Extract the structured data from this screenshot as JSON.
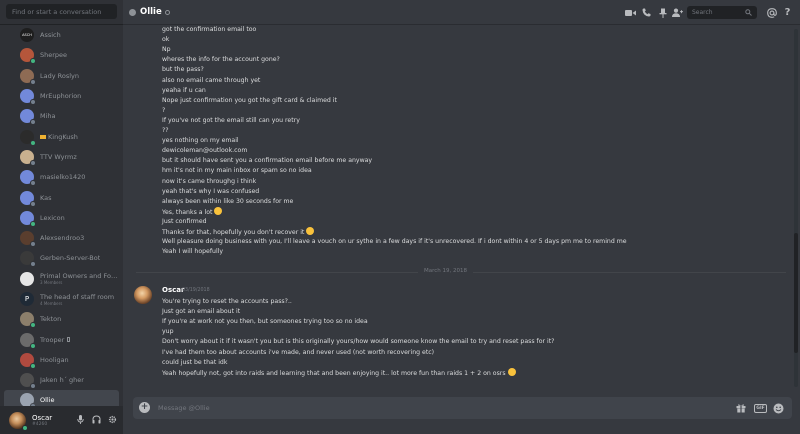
{
  "sidebar": {
    "search_placeholder": "Find or start a conversation",
    "items": [
      {
        "name": "Assich",
        "sub": "",
        "avatar_color": "#1e1e1e",
        "avatar_text": "ASCH",
        "status": "#43b581"
      },
      {
        "name": "Sherpee",
        "sub": "",
        "avatar_color": "#b5563b",
        "avatar_text": "",
        "status": "#43b581"
      },
      {
        "name": "Lady Roslyn",
        "sub": "",
        "avatar_color": "#8e6b54",
        "avatar_text": "",
        "status": "#747f8d"
      },
      {
        "name": "MrEuphorion",
        "sub": "",
        "avatar_color": "#7289da",
        "avatar_text": "",
        "status": "#747f8d"
      },
      {
        "name": "Miha",
        "sub": "",
        "avatar_color": "#7289da",
        "avatar_text": "",
        "status": "#747f8d"
      },
      {
        "name": "KingKush",
        "sub": "",
        "avatar_color": "#2b2b2b",
        "avatar_text": "",
        "status": "#43b581",
        "badge": true
      },
      {
        "name": "TTV Wyrmz",
        "sub": "",
        "avatar_color": "#c9b18f",
        "avatar_text": "",
        "status": "#747f8d"
      },
      {
        "name": "masielko1420",
        "sub": "",
        "avatar_color": "#7289da",
        "avatar_text": "",
        "status": "#747f8d"
      },
      {
        "name": "Kas",
        "sub": "",
        "avatar_color": "#7289da",
        "avatar_text": "",
        "status": "#747f8d"
      },
      {
        "name": "Lexicon",
        "sub": "",
        "avatar_color": "#7289da",
        "avatar_text": "",
        "status": "#43b581"
      },
      {
        "name": "Alexsendroo3",
        "sub": "",
        "avatar_color": "#5a3e2e",
        "avatar_text": "",
        "status": "#747f8d"
      },
      {
        "name": "Gerben-Server-Bot",
        "sub": "",
        "avatar_color": "#3a3a3a",
        "avatar_text": "",
        "status": "#747f8d"
      },
      {
        "name": "Primal Owners and Fou...",
        "sub": "3 Members",
        "avatar_color": "#e6e6e6",
        "avatar_text": "",
        "status": ""
      },
      {
        "name": "The head of staff room",
        "sub": "4 Members",
        "avatar_color": "#1f2a36",
        "avatar_text": "P",
        "status": ""
      },
      {
        "name": "Tekton",
        "sub": "",
        "avatar_color": "#8c7f6b",
        "avatar_text": "",
        "status": "#43b581"
      },
      {
        "name": "Trooper",
        "sub": "",
        "avatar_color": "#6b6b6b",
        "avatar_text": "",
        "status": "#43b581",
        "phone": true
      },
      {
        "name": "Hooligan",
        "sub": "",
        "avatar_color": "#b04a3f",
        "avatar_text": "",
        "status": "#43b581"
      },
      {
        "name": "Jaken h´ gher",
        "sub": "",
        "avatar_color": "#4f4f4f",
        "avatar_text": "",
        "status": "#747f8d"
      },
      {
        "name": "Ollie",
        "sub": "",
        "avatar_color": "#9aa3b0",
        "avatar_text": "",
        "status": "#747f8d",
        "selected": true
      }
    ]
  },
  "user_panel": {
    "name": "Oscar",
    "tag": "#4260"
  },
  "header": {
    "title": "Ollie",
    "search_placeholder": "Search"
  },
  "messages": {
    "lines": [
      "got the confirmation email too",
      "ok",
      "Np",
      "wheres the info for the account gone?",
      "but the pass?",
      "also no email came through yet",
      "yeaha if u can",
      "Nope just confirmation you got the gift card & claimed it",
      "?",
      "If you've not got the email still can you retry",
      "??",
      "yes nothing on my email",
      "dewicoleman@outlook.com",
      "but it should have sent you a confirmation email before me anyway",
      "hm it's not in my main inbox or spam so no idea",
      "now it's came throughg i think",
      "yeah that's why I was confused",
      "always been within like 30 seconds for me",
      "Yes, thanks a lot",
      "Just confirmed",
      "Thanks for that, hopefully you don't recover it",
      "Well pleasure doing business with  you, I'll leave a vouch on ur sythe in a few days if it's unrecovered. If i dont within 4 or 5 days pm me to remind me",
      "Yeah I will hopefully"
    ],
    "date_divider": "March 19, 2018",
    "oscar": {
      "name": "Oscar",
      "time": "03/19/2018",
      "lines": [
        "You're trying to reset the accounts pass?..",
        "Just got an email about it",
        "If you're at work not you then, but someones trying too so no idea",
        "yup",
        "Don't worry about it if it wasn't you but is this originally yours/how would someone know the email to try and reset pass for it?",
        "I've had them too about accounts i've made, and never used (not worth recovering etc)",
        "could just be that idk",
        "Yeah hopefully not, got into raids and learning that and been enjoying it.. lot more fun than raids 1 + 2 on osrs"
      ]
    }
  },
  "composer": {
    "placeholder": "Message @Ollie",
    "gif_label": "GIF"
  },
  "colors": {
    "online": "#43b581",
    "offline": "#747f8d",
    "accent": "#7289da"
  }
}
